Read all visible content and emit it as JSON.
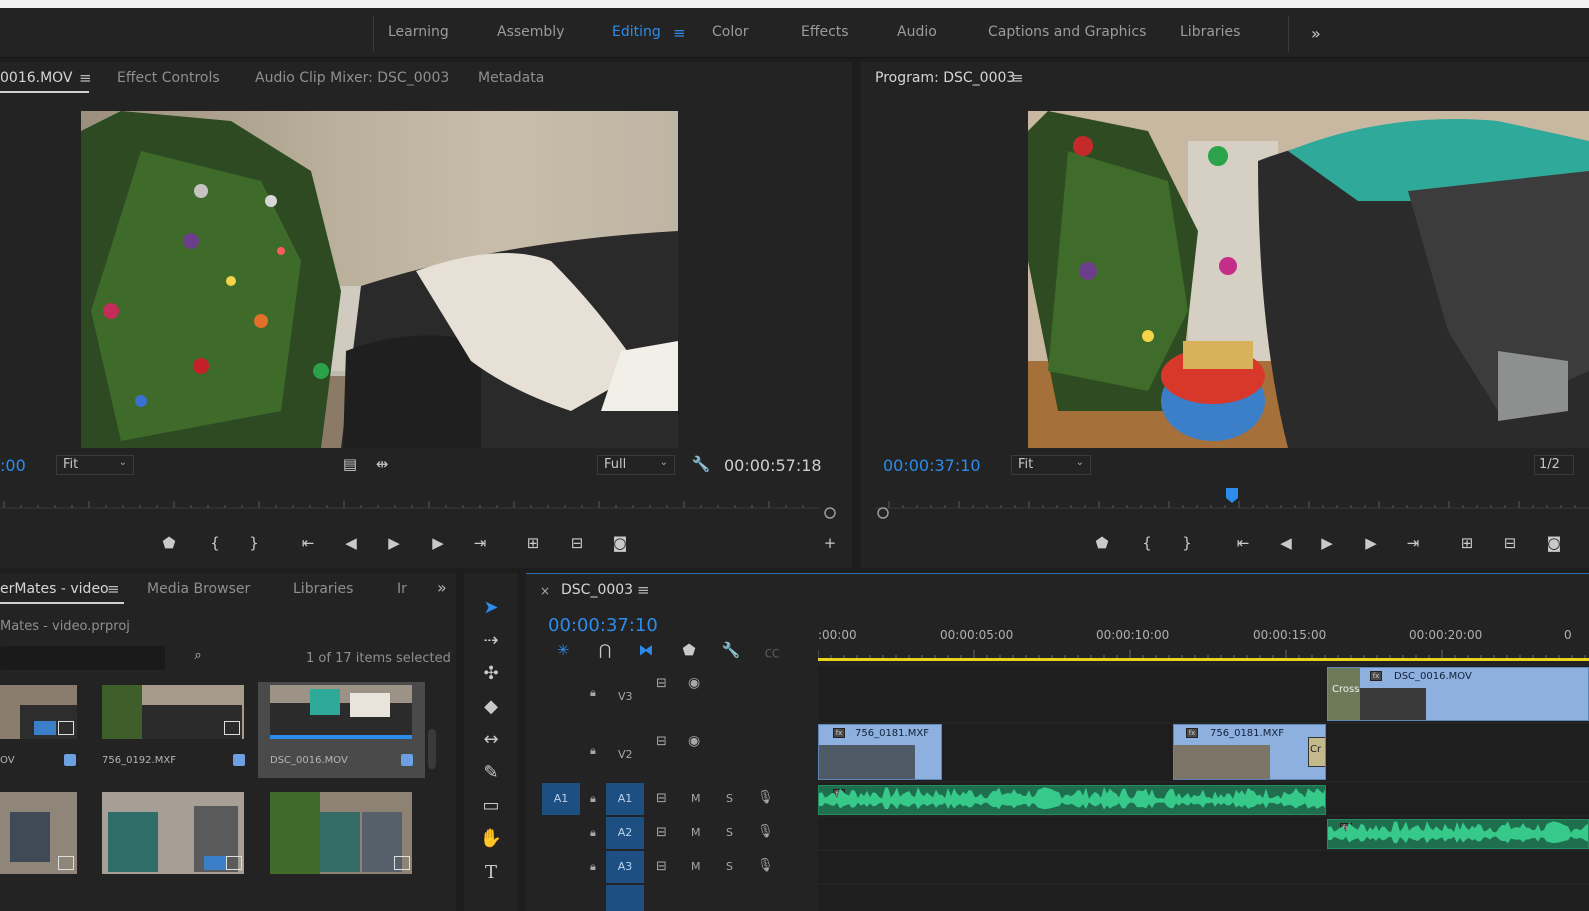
{
  "workspaces": {
    "items": [
      "Learning",
      "Assembly",
      "Editing",
      "Color",
      "Effects",
      "Audio",
      "Captions and Graphics",
      "Libraries"
    ],
    "active": "Editing",
    "overflow_icon": "double-chevron-right-icon"
  },
  "source_monitor": {
    "tabs": [
      "0016.MOV",
      "Effect Controls",
      "Audio Clip Mixer: DSC_0003",
      "Metadata"
    ],
    "active_tab": "0016.MOV",
    "timecode_in": ":00",
    "fit": "Fit",
    "resolution": "Full",
    "duration": "00:00:57:18"
  },
  "program_monitor": {
    "title": "Program: DSC_0003",
    "timecode": "00:00:37:10",
    "fit": "Fit",
    "resolution": "1/2"
  },
  "project": {
    "tabs": [
      "erMates - video",
      "Media Browser",
      "Libraries",
      "Ir"
    ],
    "active_tab": "erMates - video",
    "file": "Mates - video.prproj",
    "selection": "1 of 17 items selected",
    "items": [
      {
        "label": "OV"
      },
      {
        "label": "756_0192.MXF"
      },
      {
        "label": "DSC_0016.MOV"
      }
    ]
  },
  "timeline": {
    "sequence": "DSC_0003",
    "timecode": "00:00:37:10",
    "ruler": [
      ":00:00",
      "00:00:05:00",
      "00:00:10:00",
      "00:00:15:00",
      "00:00:20:00",
      "0"
    ],
    "tracks": {
      "v3": "V3",
      "v2": "V2",
      "a1_src": "A1",
      "a1": "A1",
      "a2": "A2",
      "a3": "A3",
      "mute": "M",
      "solo": "S"
    },
    "clips": {
      "v3_clip": "DSC_0016.MOV",
      "v3_transition": "Cross",
      "v2_clip_a": "756_0181.MXF",
      "v2_clip_b": "756_0181.MXF",
      "v2_transition": "Cr"
    }
  },
  "colors": {
    "accent": "#2d8ceb",
    "video_clip": "#8eb0df",
    "audio_clip": "#1f6f4f",
    "playhead_bar": "#e8d21b"
  }
}
